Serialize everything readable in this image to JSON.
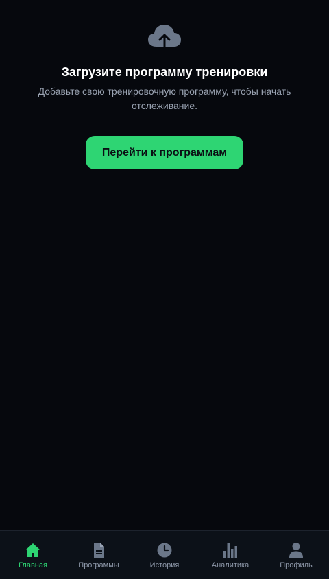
{
  "empty_state": {
    "icon": "cloud-upload-icon",
    "title": "Загрузите программу тренировки",
    "subtitle": "Добавьте свою тренировочную программу, чтобы начать отслеживание.",
    "button_label": "Перейти к программам"
  },
  "bottom_nav": {
    "active": "home",
    "items": [
      {
        "id": "home",
        "icon": "home-icon",
        "label": "Главная"
      },
      {
        "id": "programs",
        "icon": "document-icon",
        "label": "Программы"
      },
      {
        "id": "history",
        "icon": "clock-icon",
        "label": "История"
      },
      {
        "id": "analytics",
        "icon": "bar-chart-icon",
        "label": "Аналитика"
      },
      {
        "id": "profile",
        "icon": "user-icon",
        "label": "Профиль"
      }
    ]
  },
  "colors": {
    "background": "#06080d",
    "accent": "#2ed573",
    "muted": "#8d97a8",
    "icon": "#6b7789"
  }
}
